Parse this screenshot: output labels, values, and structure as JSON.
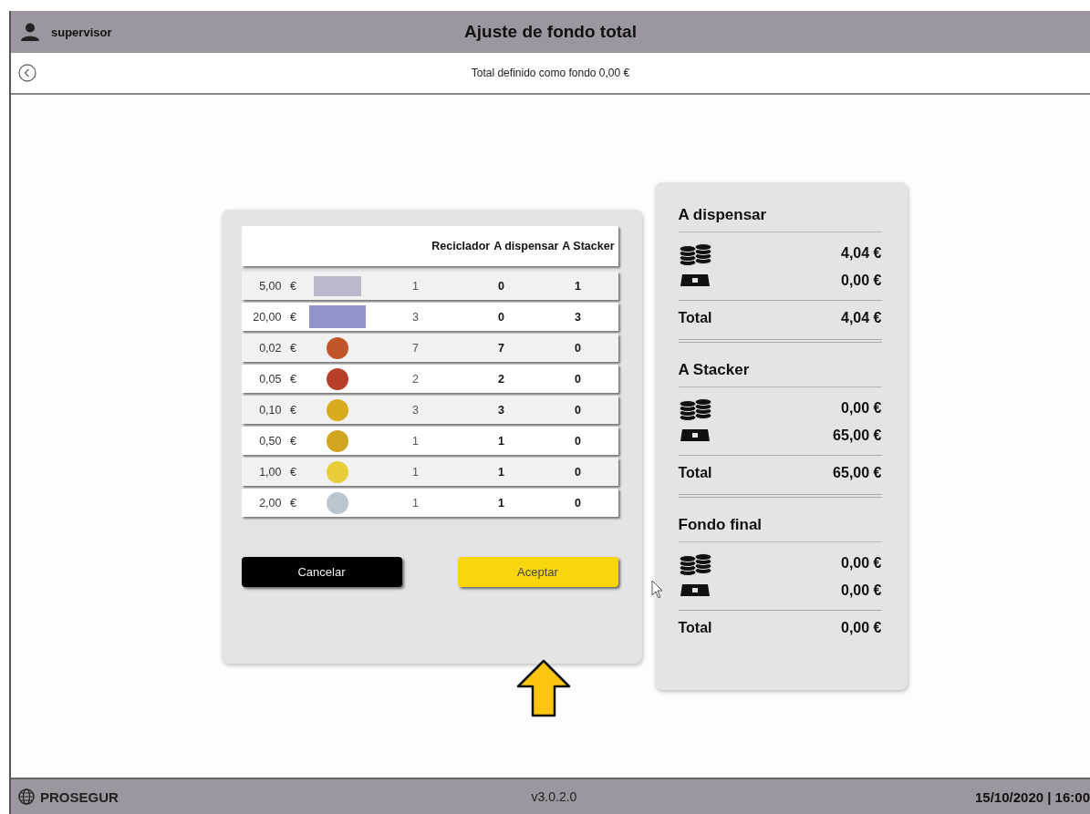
{
  "header": {
    "user": "supervisor",
    "title": "Ajuste de fondo total"
  },
  "subheader": {
    "text": "Total definido como fondo 0,00 €"
  },
  "table": {
    "columns": [
      "Reciclador",
      "A dispensar",
      "A Stacker"
    ],
    "rows": [
      {
        "value": "5,00",
        "currency": "€",
        "kind": "banknote",
        "color": "#b9b9c9",
        "recycler": "1",
        "dispense": "0",
        "stacker": "1"
      },
      {
        "value": "20,00",
        "currency": "€",
        "kind": "banknote",
        "color": "#8f95c8",
        "recycler": "3",
        "dispense": "0",
        "stacker": "3"
      },
      {
        "value": "0,02",
        "currency": "€",
        "kind": "coin",
        "color": "#c0562a",
        "recycler": "7",
        "dispense": "7",
        "stacker": "0"
      },
      {
        "value": "0,05",
        "currency": "€",
        "kind": "coin",
        "color": "#b8402a",
        "recycler": "2",
        "dispense": "2",
        "stacker": "0"
      },
      {
        "value": "0,10",
        "currency": "€",
        "kind": "coin",
        "color": "#d9aa1e",
        "recycler": "3",
        "dispense": "3",
        "stacker": "0"
      },
      {
        "value": "0,50",
        "currency": "€",
        "kind": "coin",
        "color": "#d2a520",
        "recycler": "1",
        "dispense": "1",
        "stacker": "0"
      },
      {
        "value": "1,00",
        "currency": "€",
        "kind": "coin",
        "color": "#e8cc3a",
        "recycler": "1",
        "dispense": "1",
        "stacker": "0"
      },
      {
        "value": "2,00",
        "currency": "€",
        "kind": "coin",
        "color": "#b9c6cf",
        "recycler": "1",
        "dispense": "1",
        "stacker": "0"
      }
    ]
  },
  "buttons": {
    "cancel": "Cancelar",
    "accept": "Aceptar"
  },
  "summary": [
    {
      "title": "A dispensar",
      "coins": "4,04 €",
      "notes": "0,00 €",
      "total_label": "Total",
      "total": "4,04 €"
    },
    {
      "title": "A Stacker",
      "coins": "0,00 €",
      "notes": "65,00 €",
      "total_label": "Total",
      "total": "65,00 €"
    },
    {
      "title": "Fondo final",
      "coins": "0,00 €",
      "notes": "0,00 €",
      "total_label": "Total",
      "total": "0,00 €"
    }
  ],
  "footer": {
    "brand": "PROSEGUR",
    "version": "v3.0.2.0",
    "datetime": "15/10/2020 | 16:00"
  }
}
